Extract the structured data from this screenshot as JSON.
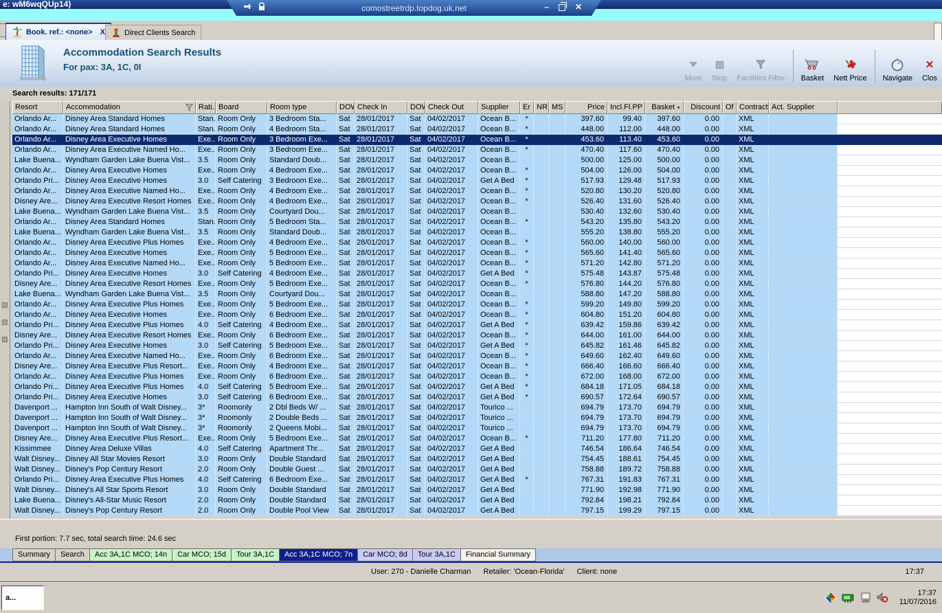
{
  "window": {
    "title_fragment": "e: wM6wqQUp14)"
  },
  "rdp_bar": {
    "host": "comostreetrdp.topdog.uk.net",
    "icons": [
      "pin-icon",
      "lock-icon"
    ],
    "buttons": [
      "minimize",
      "restore",
      "close"
    ]
  },
  "app_tabs": [
    {
      "label": "Book. ref.: <none>",
      "icon": "palm-tree-icon",
      "close_label": "X",
      "active": true
    },
    {
      "label": "Direct Clients Search",
      "icon": "person-icon",
      "active": false
    }
  ],
  "header": {
    "title": "Accommodation Search Results",
    "subtitle": "For pax: 3A, 1C, 0I",
    "icon": "building-icon"
  },
  "toolbar": {
    "items": [
      {
        "label": "More",
        "icon": "triangle-down-icon",
        "enabled": false
      },
      {
        "label": "Stop",
        "icon": "stop-square-icon",
        "enabled": false
      },
      {
        "label": "Facilities Filter",
        "icon": "funnel-icon",
        "enabled": false
      },
      {
        "sep": true
      },
      {
        "label": "Basket",
        "icon": "cart-icon",
        "enabled": true
      },
      {
        "label": "Nett Price",
        "icon": "flower-icon",
        "enabled": true
      },
      {
        "sep": true
      },
      {
        "label": "Navigate",
        "icon": "compass-icon",
        "enabled": true
      },
      {
        "label": "Clos",
        "icon": "close-x-icon",
        "enabled": true
      }
    ]
  },
  "results_bar": {
    "label": "Search results: 171/171"
  },
  "table": {
    "columns": [
      {
        "label": "Resort"
      },
      {
        "label": "Accommodation",
        "filter_icon": true
      },
      {
        "label": "Rati..."
      },
      {
        "label": "Board"
      },
      {
        "label": "Room type"
      },
      {
        "label": "DOW"
      },
      {
        "label": "Check In"
      },
      {
        "label": "DOW"
      },
      {
        "label": "Check Out"
      },
      {
        "label": "Supplier"
      },
      {
        "label": "Er"
      },
      {
        "label": "NR"
      },
      {
        "label": "MS"
      },
      {
        "label": "Price",
        "align": "right"
      },
      {
        "label": "Incl.Fl.PP",
        "align": "right"
      },
      {
        "label": "Basket",
        "align": "right",
        "sort_icon": true
      },
      {
        "label": "Discount",
        "align": "right"
      },
      {
        "label": "Of"
      },
      {
        "label": "Contract"
      },
      {
        "label": "Act. Supplier"
      }
    ],
    "row_constants": {
      "dow": "Sat",
      "check_in": "28/01/2017",
      "check_out": "04/02/2017",
      "discount": "0.00",
      "contract": "XML"
    },
    "selected_index": 2,
    "rows": [
      [
        "Orlando Ar...",
        "Disney Area Standard Homes",
        "Stan...",
        "Room Only",
        "3 Bedroom Sta...",
        "Ocean B...",
        "*",
        "397.60",
        "99.40",
        "397.60"
      ],
      [
        "Orlando Ar...",
        "Disney Area Standard Homes",
        "Stan...",
        "Room Only",
        "4 Bedroom Sta...",
        "Ocean B...",
        "*",
        "448.00",
        "112.00",
        "448.00"
      ],
      [
        "Orlando Ar...",
        "Disney Area Executive Homes",
        "Exe...",
        "Room Only",
        "3 Bedroom Exe...",
        "Ocean B...",
        "*",
        "453.60",
        "113.40",
        "453.60"
      ],
      [
        "Orlando Ar...",
        "Disney Area Executive Named Ho...",
        "Exe...",
        "Room Only",
        "3 Bedroom Exe...",
        "Ocean B...",
        "*",
        "470.40",
        "117.60",
        "470.40"
      ],
      [
        "Lake Buena...",
        "Wyndham Garden Lake Buena Vist...",
        "3.5",
        "Room Only",
        "Standard Doub...",
        "Ocean B...",
        "",
        "500.00",
        "125.00",
        "500.00"
      ],
      [
        "Orlando Ar...",
        "Disney Area Executive Homes",
        "Exe...",
        "Room Only",
        "4 Bedroom Exe...",
        "Ocean B...",
        "*",
        "504.00",
        "126.00",
        "504.00"
      ],
      [
        "Orlando Pri...",
        "Disney Area Executive Homes",
        "3.0",
        "Self Catering",
        "3 Bedroom Exe...",
        "Get A Bed",
        "*",
        "517.93",
        "129.48",
        "517.93"
      ],
      [
        "Orlando Ar...",
        "Disney Area Executive Named Ho...",
        "Exe...",
        "Room Only",
        "4 Bedroom Exe...",
        "Ocean B...",
        "*",
        "520.80",
        "130.20",
        "520.80"
      ],
      [
        "Disney Are...",
        "Disney Area Executive Resort Homes",
        "Exe...",
        "Room Only",
        "4 Bedroom Exe...",
        "Ocean B...",
        "*",
        "526.40",
        "131.60",
        "526.40"
      ],
      [
        "Lake Buena...",
        "Wyndham Garden Lake Buena Vist...",
        "3.5",
        "Room Only",
        "Courtyard Dou...",
        "Ocean B...",
        "",
        "530.40",
        "132.60",
        "530.40"
      ],
      [
        "Orlando Ar...",
        "Disney Area Standard Homes",
        "Stan...",
        "Room Only",
        "5 Bedroom Sta...",
        "Ocean B...",
        "*",
        "543.20",
        "135.80",
        "543.20"
      ],
      [
        "Lake Buena...",
        "Wyndham Garden Lake Buena Vist...",
        "3.5",
        "Room Only",
        "Standard Doub...",
        "Ocean B...",
        "",
        "555.20",
        "138.80",
        "555.20"
      ],
      [
        "Orlando Ar...",
        "Disney Area Executive Plus Homes",
        "Exe...",
        "Room Only",
        "4 Bedroom Exe...",
        "Ocean B...",
        "*",
        "560.00",
        "140.00",
        "560.00"
      ],
      [
        "Orlando Ar...",
        "Disney Area Executive Homes",
        "Exe...",
        "Room Only",
        "5 Bedroom Exe...",
        "Ocean B...",
        "*",
        "565.60",
        "141.40",
        "565.60"
      ],
      [
        "Orlando Ar...",
        "Disney Area Executive Named Ho...",
        "Exe...",
        "Room Only",
        "5 Bedroom Exe...",
        "Ocean B...",
        "*",
        "571.20",
        "142.80",
        "571.20"
      ],
      [
        "Orlando Pri...",
        "Disney Area Executive Homes",
        "3.0",
        "Self Catering",
        "4 Bedroom Exe...",
        "Get A Bed",
        "*",
        "575.48",
        "143.87",
        "575.48"
      ],
      [
        "Disney Are...",
        "Disney Area Executive Resort Homes",
        "Exe...",
        "Room Only",
        "5 Bedroom Exe...",
        "Ocean B...",
        "*",
        "576.80",
        "144.20",
        "576.80"
      ],
      [
        "Lake Buena...",
        "Wyndham Garden Lake Buena Vist...",
        "3.5",
        "Room Only",
        "Courtyard Dou...",
        "Ocean B...",
        "",
        "588.80",
        "147.20",
        "588.80"
      ],
      [
        "Orlando Ar...",
        "Disney Area Executive Plus Homes",
        "Exe...",
        "Room Only",
        "5 Bedroom Exe...",
        "Ocean B...",
        "*",
        "599.20",
        "149.80",
        "599.20"
      ],
      [
        "Orlando Ar...",
        "Disney Area Executive Homes",
        "Exe...",
        "Room Only",
        "6 Bedroom Exe...",
        "Ocean B...",
        "*",
        "604.80",
        "151.20",
        "604.80"
      ],
      [
        "Orlando Pri...",
        "Disney Area Executive Plus Homes",
        "4.0",
        "Self Catering",
        "4 Bedroom Exe...",
        "Get A Bed",
        "*",
        "639.42",
        "159.86",
        "639.42"
      ],
      [
        "Disney Are...",
        "Disney Area Executive Resort Homes",
        "Exe...",
        "Room Only",
        "6 Bedroom Exe...",
        "Ocean B...",
        "*",
        "644.00",
        "161.00",
        "644.00"
      ],
      [
        "Orlando Pri...",
        "Disney Area Executive Homes",
        "3.0",
        "Self Catering",
        "5 Bedroom Exe...",
        "Get A Bed",
        "*",
        "645.82",
        "161.46",
        "645.82"
      ],
      [
        "Orlando Ar...",
        "Disney Area Executive Named Ho...",
        "Exe...",
        "Room Only",
        "6 Bedroom Exe...",
        "Ocean B...",
        "*",
        "649.60",
        "162.40",
        "649.60"
      ],
      [
        "Disney Are...",
        "Disney Area Executive Plus Resort...",
        "Exe...",
        "Room Only",
        "4 Bedroom Exe...",
        "Ocean B...",
        "*",
        "666.40",
        "166.60",
        "666.40"
      ],
      [
        "Orlando Ar...",
        "Disney Area Executive Plus Homes",
        "Exe...",
        "Room Only",
        "6 Bedroom Exe...",
        "Ocean B...",
        "*",
        "672.00",
        "168.00",
        "672.00"
      ],
      [
        "Orlando Pri...",
        "Disney Area Executive Plus Homes",
        "4.0",
        "Self Catering",
        "5 Bedroom Exe...",
        "Get A Bed",
        "*",
        "684.18",
        "171.05",
        "684.18"
      ],
      [
        "Orlando Pri...",
        "Disney Area Executive Homes",
        "3.0",
        "Self Catering",
        "6 Bedroom Exe...",
        "Get A Bed",
        "*",
        "690.57",
        "172.64",
        "690.57"
      ],
      [
        "Davenport ...",
        "Hampton Inn South of Walt Disney...",
        "3*",
        "Roomonly",
        "2 Dbl Beds W/ ...",
        "Tourico ...",
        "",
        "694.79",
        "173.70",
        "694.79"
      ],
      [
        "Davenport ...",
        "Hampton Inn South of Walt Disney...",
        "3*",
        "Roomonly",
        "2 Double Beds ...",
        "Tourico ...",
        "",
        "694.79",
        "173.70",
        "694.79"
      ],
      [
        "Davenport ...",
        "Hampton Inn South of Walt Disney...",
        "3*",
        "Roomonly",
        "2 Queens Mobi...",
        "Tourico ...",
        "",
        "694.79",
        "173.70",
        "694.79"
      ],
      [
        "Disney Are...",
        "Disney Area Executive Plus Resort...",
        "Exe...",
        "Room Only",
        "5 Bedroom Exe...",
        "Ocean B...",
        "*",
        "711.20",
        "177.80",
        "711.20"
      ],
      [
        "Kissimmee",
        "Disney Area Deluxe Villas",
        "4.0",
        "Self Catering",
        "Apartment Thr...",
        "Get A Bed",
        "",
        "746.54",
        "186.64",
        "746.54"
      ],
      [
        "Walt Disney...",
        "Disney All Star Movies Resort",
        "3.0",
        "Room Only",
        "Double Standard",
        "Get A Bed",
        "",
        "754.45",
        "188.61",
        "754.45"
      ],
      [
        "Walt Disney...",
        "Disney's Pop Century Resort",
        "2.0",
        "Room Only",
        "Double Guest ...",
        "Get A Bed",
        "",
        "758.88",
        "189.72",
        "758.88"
      ],
      [
        "Orlando Pri...",
        "Disney Area Executive Plus Homes",
        "4.0",
        "Self Catering",
        "6 Bedroom Exe...",
        "Get A Bed",
        "*",
        "767.31",
        "191.83",
        "767.31"
      ],
      [
        "Walt Disney...",
        "Disney's All Star Sports Resort",
        "3.0",
        "Room Only",
        "Double Standard",
        "Get A Bed",
        "",
        "771.90",
        "192.98",
        "771.90"
      ],
      [
        "Lake Buena...",
        "Disney's All-Star Music Resort",
        "2.0",
        "Room Only",
        "Double Standard",
        "Get A Bed",
        "",
        "792.84",
        "198.21",
        "792.84"
      ],
      [
        "Walt Disney...",
        "Disney's Pop Century Resort",
        "2.0",
        "Room Only",
        "Double Pool View",
        "Get A Bed",
        "",
        "797.15",
        "199.29",
        "797.15"
      ]
    ]
  },
  "footer": {
    "timing": "First portion: 7.7 sec, total search time: 24.6 sec"
  },
  "bottom_tabs": [
    {
      "label": "Summary",
      "style": "gray"
    },
    {
      "label": "Search",
      "style": "gray"
    },
    {
      "label": "Acc 3A,1C MCO; 14n",
      "style": "green"
    },
    {
      "label": "Car MCO; 15d",
      "style": "green"
    },
    {
      "label": "Tour 3A,1C",
      "style": "green"
    },
    {
      "label": "Acc 3A,1C MCO; 7n",
      "style": "navy",
      "selected": true
    },
    {
      "label": "Car MCO; 8d",
      "style": "lavender"
    },
    {
      "label": "Tour 3A,1C",
      "style": "lavender"
    },
    {
      "label": "Financial Summary",
      "style": "white"
    }
  ],
  "status_bar": {
    "parts": [
      "User: 270 - Danielle Charman",
      "Retailer: 'Ocean-Florida'",
      "Client: none"
    ],
    "time": "17:37"
  },
  "taskbar": {
    "button_label": "a...",
    "tray_icons": [
      "antivirus-icon",
      "network-icon",
      "display-icon",
      "audio-muted-icon"
    ],
    "clock_time": "17:37",
    "clock_date": "11/07/2016"
  },
  "colors": {
    "selected_row": "#0d2a6e",
    "row_blue": "#b3d9f8",
    "accent_navy": "#123a7c",
    "header_title": "#1a5276",
    "cyan_strip": "#97fcfe",
    "tab_styles": {
      "gray": {
        "bg": "#d6d2ca",
        "fg": "#000000"
      },
      "green": {
        "bg": "#c9f3c6",
        "fg": "#000000"
      },
      "navy": {
        "bg": "#101f8c",
        "fg": "#ffffff"
      },
      "lavender": {
        "bg": "#cacaf8",
        "fg": "#000000"
      },
      "white": {
        "bg": "#f2f2ea",
        "fg": "#000000"
      }
    }
  }
}
